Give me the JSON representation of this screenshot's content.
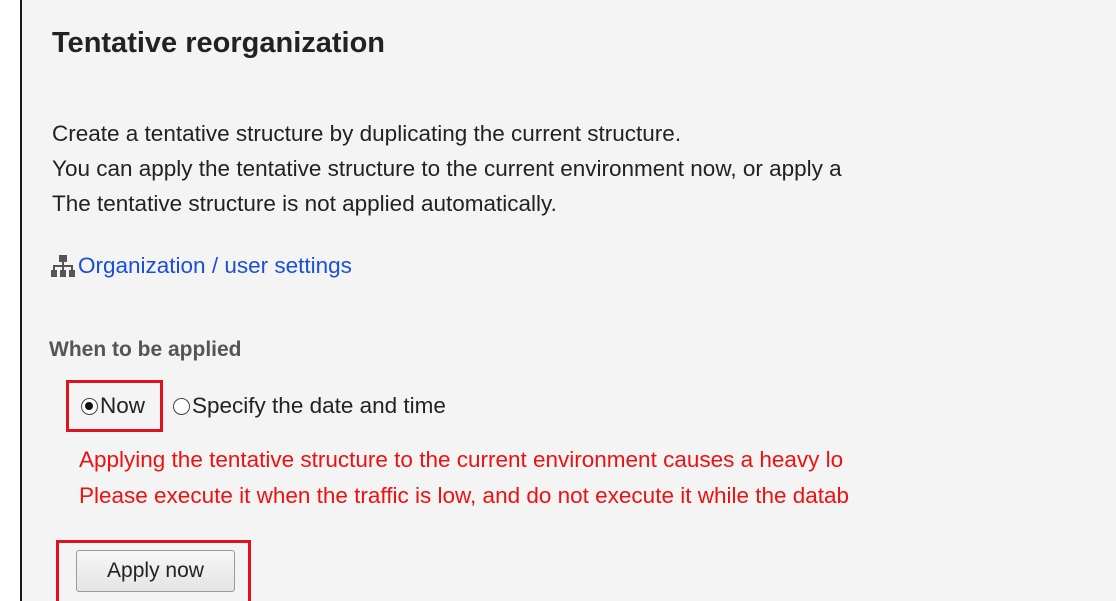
{
  "page": {
    "title": "Tentative reorganization",
    "description": [
      "Create a tentative structure by duplicating the current structure.",
      "You can apply the tentative structure to the current environment now, or apply a",
      "The tentative structure is not applied automatically."
    ],
    "org_link": {
      "icon": "org-chart-icon",
      "label": "Organization / user settings"
    },
    "when_applied": {
      "label": "When to be applied",
      "options": [
        {
          "label": "Now",
          "checked": true
        },
        {
          "label": "Specify the date and time",
          "checked": false
        }
      ]
    },
    "warnings": [
      "Applying the tentative structure to the current environment causes a heavy lo",
      "Please execute it when the traffic is low, and do not execute it while the datab"
    ],
    "apply_button_label": "Apply now"
  },
  "colors": {
    "link": "#1a4fd6",
    "warning": "#ee1111",
    "highlight_border": "#e0121e",
    "panel_background": "#f4f4f4"
  }
}
